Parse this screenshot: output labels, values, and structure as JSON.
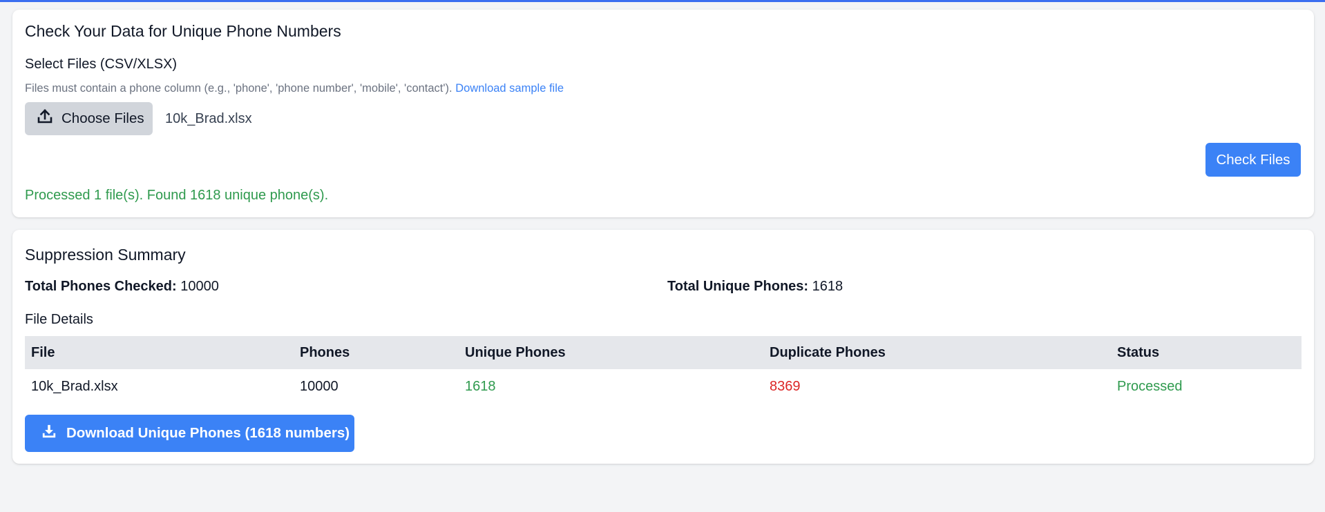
{
  "upload": {
    "title": "Check Your Data for Unique Phone Numbers",
    "select_label": "Select Files (CSV/XLSX)",
    "hint": "Files must contain a phone column (e.g., 'phone', 'phone number', 'mobile', 'contact').",
    "sample_link": "Download sample file",
    "choose_button": "Choose Files",
    "chosen_file": "10k_Brad.xlsx",
    "check_button": "Check Files",
    "status_message": "Processed 1 file(s). Found 1618 unique phone(s)."
  },
  "summary": {
    "title": "Suppression Summary",
    "total_checked_label": "Total Phones Checked:",
    "total_checked_value": "10000",
    "total_unique_label": "Total Unique Phones:",
    "total_unique_value": "1618",
    "file_details_title": "File Details",
    "table": {
      "headers": [
        "File",
        "Phones",
        "Unique Phones",
        "Duplicate Phones",
        "Status"
      ],
      "rows": [
        {
          "file": "10k_Brad.xlsx",
          "phones": "10000",
          "unique": "1618",
          "duplicate": "8369",
          "status": "Processed"
        }
      ]
    },
    "download_button": "Download Unique Phones (1618 numbers)"
  },
  "colors": {
    "accent": "#3b82f6",
    "top_bar": "#3b6ef0",
    "success": "#2f9a4e",
    "danger": "#dc2626",
    "table_header_bg": "#e5e7eb"
  },
  "icons": {
    "choose_files": "upload-icon",
    "download": "download-icon"
  }
}
